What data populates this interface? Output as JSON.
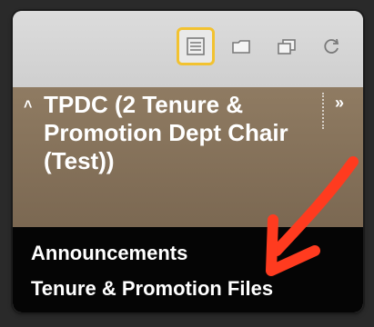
{
  "toolbar": {
    "tools": [
      {
        "icon": "list-icon",
        "active": true
      },
      {
        "icon": "folder-icon",
        "active": false
      },
      {
        "icon": "windows-icon",
        "active": false
      },
      {
        "icon": "refresh-icon",
        "active": false
      }
    ]
  },
  "course": {
    "collapse_glyph": "˄",
    "title": "TPDC (2 Tenure & Promotion Dept Chair (Test))",
    "more_glyph": "»"
  },
  "menu": {
    "items": [
      {
        "label": "Announcements"
      },
      {
        "label": "Tenure & Promotion Files"
      }
    ]
  },
  "colors": {
    "accent_yellow": "#f2c230",
    "course_bg": "#8f7b62",
    "menu_bg": "#050505",
    "arrow_red": "#ff3b1f"
  }
}
